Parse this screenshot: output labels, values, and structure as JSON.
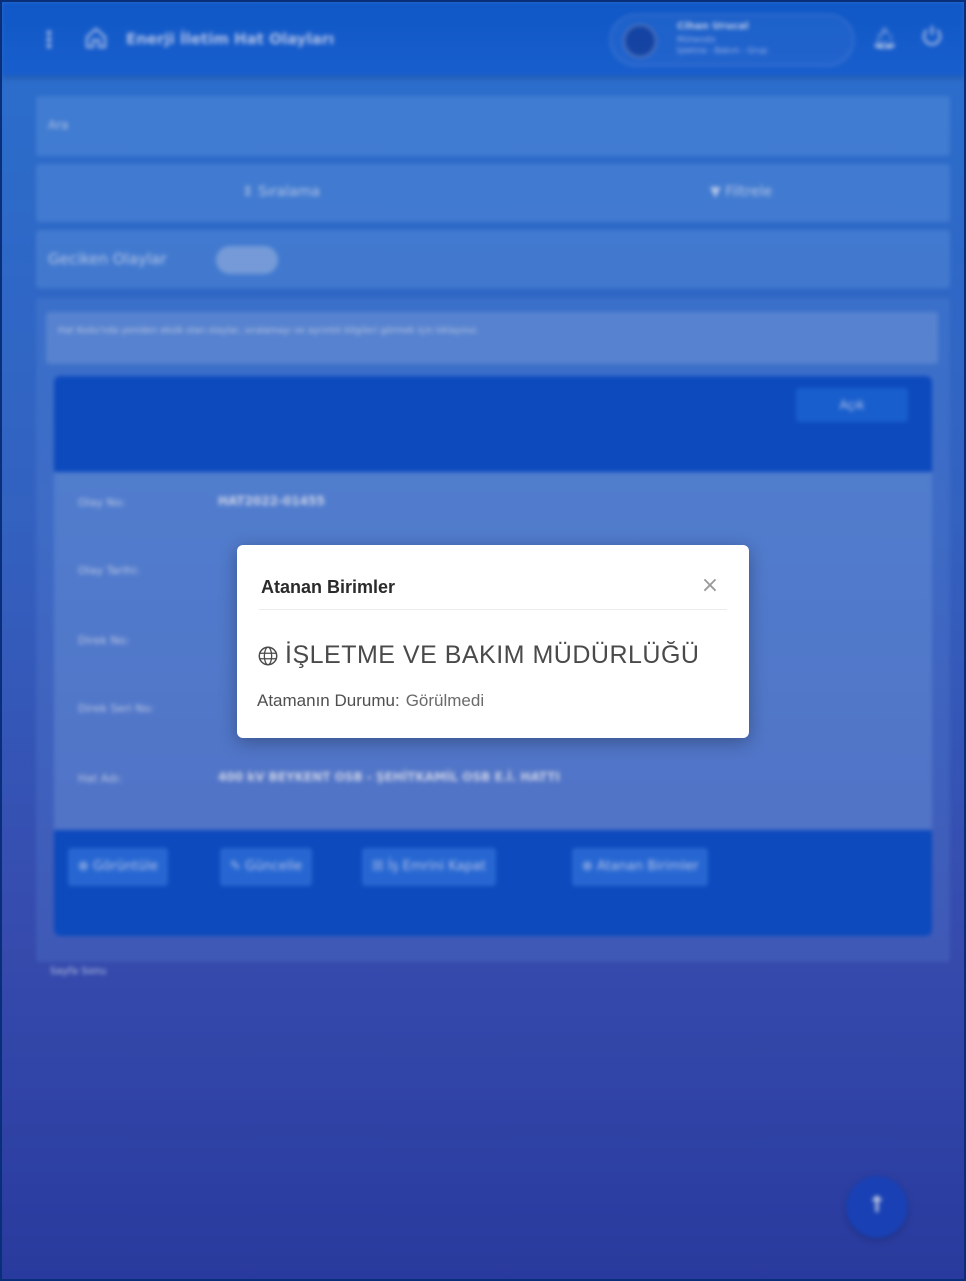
{
  "topbar": {
    "menu_icon": "kebab-icon",
    "home_icon": "home-icon",
    "title": "Enerji İletim Hat Olayları",
    "user_name": "Cihan Urucal",
    "user_role": "Mühendis",
    "user_unit": "İşletme - Bakım - Grup",
    "bell_icon": "bell-icon",
    "power_icon": "power-icon"
  },
  "search": {
    "label": "Ara"
  },
  "sortbar": {
    "sort_label": "⇕ Sıralama",
    "filter_label": "▼ Filtrele"
  },
  "late_events": {
    "label": "Geciken Olaylar"
  },
  "info_text": "Hat Kodu'nda yeniden eksik olan olaylar, sıralamayı ve ayrıntılı bilgileri görmek için tıklayınız.",
  "card": {
    "header_button": "Açık",
    "rows": [
      {
        "label": "Olay No:",
        "value": "HAT2022-01455"
      },
      {
        "label": "Olay Tarihi:",
        "value": ""
      },
      {
        "label": "Direk No:",
        "value": ""
      },
      {
        "label": "Direk Seri No:",
        "value": ""
      },
      {
        "label": "Hat Adı:",
        "value": "400 kV BEYKENT OSB - ŞEHİTKAMİL OSB E.İ. HATTI"
      }
    ],
    "footer_buttons": [
      "⊕ Görüntüle",
      "✎ Güncelle",
      "☒ İş Emrini Kapat",
      "⊕ Atanan Birimler"
    ]
  },
  "pager": {
    "label": "Sayfa Sonu"
  },
  "fab": {
    "label": "↑"
  },
  "modal": {
    "title": "Atanan Birimler",
    "close_label": "×",
    "unit_icon": "globe-icon",
    "unit_name": "İŞLETME VE BAKIM MÜDÜRLÜĞÜ",
    "status_label": "Atamanın Durumu:",
    "status_value": "Görülmedi"
  }
}
